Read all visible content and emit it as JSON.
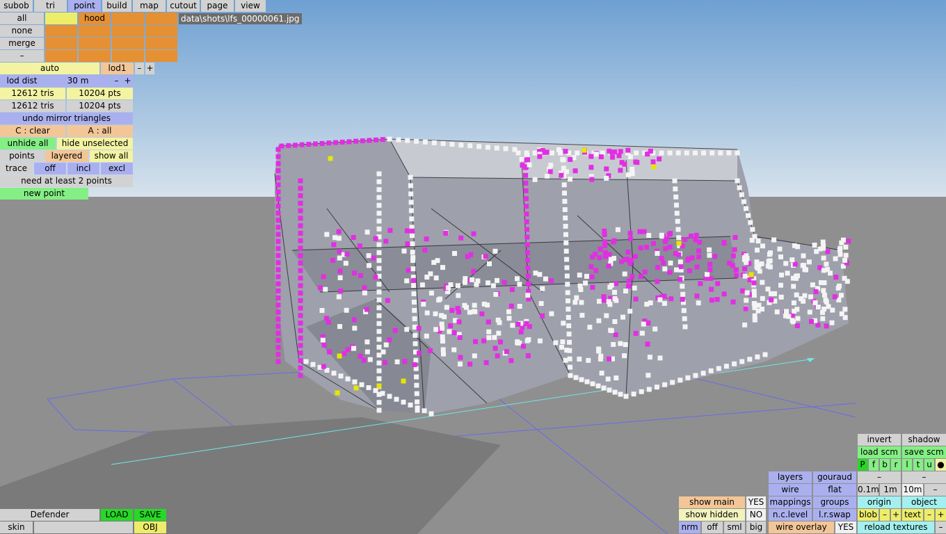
{
  "menu": {
    "subob": "subob",
    "tri": "tri",
    "point": "point",
    "build": "build",
    "map": "map",
    "cutout": "cutout",
    "page": "page",
    "view": "view"
  },
  "file_path": "data\\shots\\lfs_00000061.jpg",
  "subobject_panel": {
    "all": "all",
    "none": "none",
    "merge": "merge",
    "dash": "–",
    "hood": "hood"
  },
  "lod": {
    "auto": "auto",
    "lod1": "lod1",
    "minus": "–",
    "plus": "+",
    "lod_dist_label": "lod dist",
    "lod_dist_value": "30 m"
  },
  "stats": {
    "tris_a": "12612 tris",
    "pts_a": "10204 pts",
    "tris_b": "12612 tris",
    "pts_b": "10204 pts"
  },
  "tools": {
    "undo_mirror": "undo mirror triangles",
    "c_clear": "C : clear",
    "a_all": "A : all",
    "unhide_all": "unhide all",
    "hide_unselected": "hide unselected",
    "points": "points",
    "layered": "layered",
    "show_all": "show all",
    "trace": "trace",
    "off": "off",
    "incl": "incl",
    "excl": "excl",
    "status": "need at least 2 points",
    "new_point": "new point"
  },
  "bottom_left": {
    "car_name": "Defender",
    "load": "LOAD",
    "save": "SAVE",
    "skin": "skin",
    "obj": "OBJ"
  },
  "bottom_mid": {
    "show_main": "show main",
    "yes": "YES",
    "show_hidden": "show hidden",
    "no": "NO",
    "nrm": "nrm",
    "off": "off",
    "sml": "sml",
    "big": "big"
  },
  "bottom_render": {
    "layers": "layers",
    "gouraud": "gouraud",
    "wire": "wire",
    "flat": "flat",
    "mappings": "mappings",
    "groups": "groups",
    "nc_level": "n.c.level",
    "lr_swap": "l.r.swap",
    "wire_overlay": "wire overlay",
    "yes": "YES"
  },
  "bottom_right": {
    "invert": "invert",
    "shadow": "shadow",
    "load_scm": "load scm",
    "save_scm": "save scm",
    "filters": [
      "P",
      "f",
      "b",
      "r",
      "l",
      "t",
      "u"
    ],
    "dot": "●",
    "dash": "–",
    "m01": "0.1m",
    "m1": "1m",
    "m10": "10m",
    "origin": "origin",
    "object": "object",
    "blob": "blob",
    "text": "text",
    "minus": "–",
    "plus": "+",
    "reload_textures": "reload textures"
  },
  "colors": {
    "selected_point": "#e22ee2",
    "unselected_point": "#f4f4f4",
    "yellow_point": "#e6e600",
    "mesh_fill": "#9ea0ac",
    "floor": "#8f8f8f",
    "sky_top": "#6ea0d2"
  }
}
